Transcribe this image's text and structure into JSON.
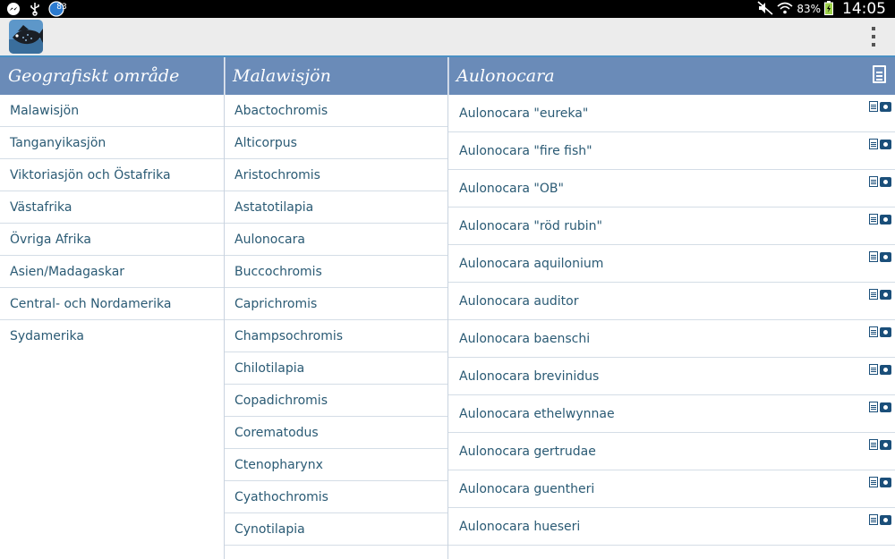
{
  "status_bar": {
    "notification_count": "83",
    "battery": "83%",
    "time": "14:05"
  },
  "app": {
    "logo_icon": "fish-logo-icon",
    "overflow_icon": "overflow-menu-icon"
  },
  "colors": {
    "header_bg": "#6a8bb8",
    "link_text": "#2a5a74",
    "action_bar_bg": "#ececec",
    "accent": "#4a90c4"
  },
  "pane1": {
    "title": "Geografiskt område",
    "items": [
      "Malawisjön",
      "Tanganyikasjön",
      "Viktoriasjön och Östafrika",
      "Västafrika",
      "Övriga Afrika",
      "Asien/Madagaskar",
      "Central- och Nordamerika",
      "Sydamerika"
    ]
  },
  "pane2": {
    "title": "Malawisjön",
    "items": [
      "Abactochromis",
      "Alticorpus",
      "Aristochromis",
      "Astatotilapia",
      "Aulonocara",
      "Buccochromis",
      "Caprichromis",
      "Champsochromis",
      "Chilotilapia",
      "Copadichromis",
      "Corematodus",
      "Ctenopharynx",
      "Cyathochromis",
      "Cynotilapia"
    ]
  },
  "pane3": {
    "title": "Aulonocara",
    "header_icon": "document-icon",
    "items": [
      "Aulonocara \"eureka\"",
      "Aulonocara \"fire fish\"",
      "Aulonocara \"OB\"",
      "Aulonocara \"röd rubin\"",
      "Aulonocara aquilonium",
      "Aulonocara auditor",
      "Aulonocara baenschi",
      "Aulonocara brevinidus",
      "Aulonocara ethelwynnae",
      "Aulonocara gertrudae",
      "Aulonocara guentheri",
      "Aulonocara hueseri"
    ]
  }
}
